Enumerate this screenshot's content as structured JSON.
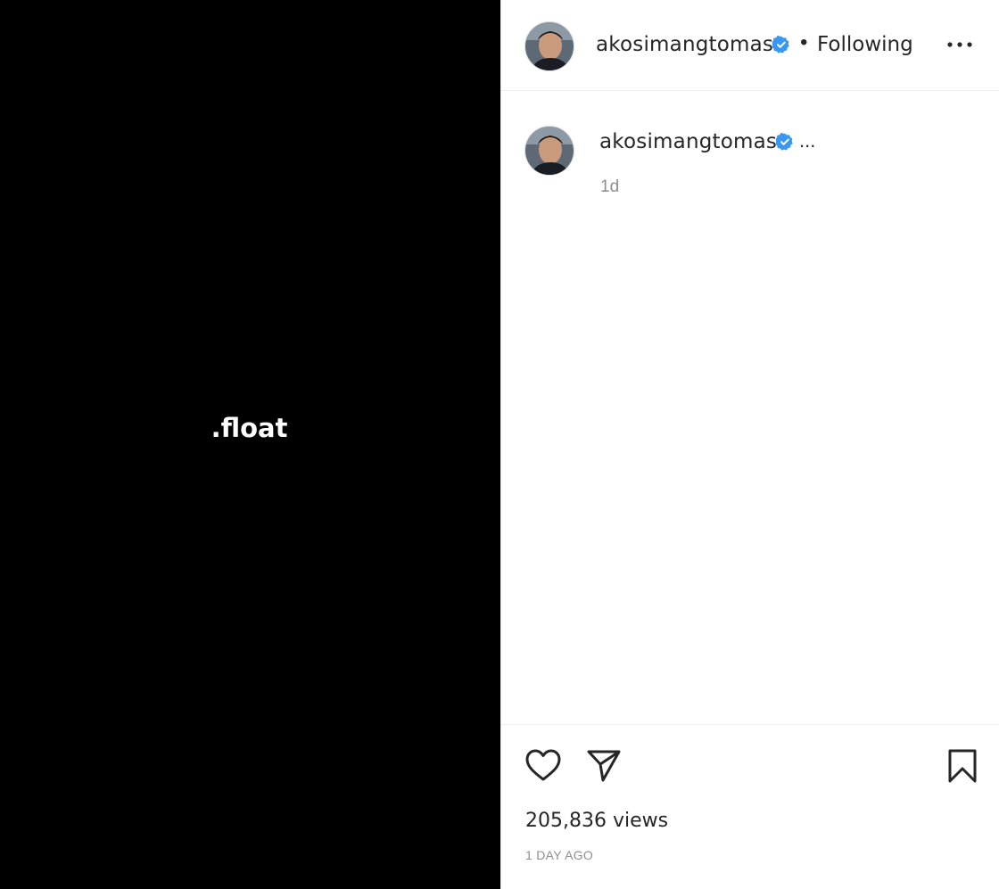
{
  "media": {
    "overlay_text": ".float"
  },
  "header": {
    "username": "akosimangtomas",
    "separator": "•",
    "follow_status": "Following",
    "more_icon": "more-horizontal-icon"
  },
  "comment": {
    "username": "akosimangtomas",
    "ellipsis": "...",
    "time": "1d"
  },
  "actions": {
    "like_icon": "heart-icon",
    "share_icon": "paper-plane-icon",
    "save_icon": "bookmark-icon",
    "views": "205,836 views",
    "posted": "1 DAY AGO"
  },
  "colors": {
    "verified_badge": "#3897f0",
    "secondary_text": "#8e8e8e"
  }
}
